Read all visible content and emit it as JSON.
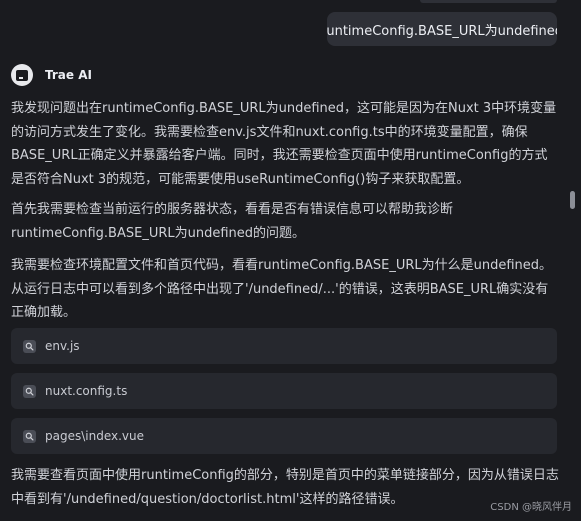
{
  "user_message": "runtimeConfig.BASE_URL为undefined",
  "assistant": {
    "name": "Trae AI"
  },
  "paragraphs": [
    "我发现问题出在runtimeConfig.BASE_URL为undefined，这可能是因为在Nuxt 3中环境变量的访问方式发生了变化。我需要检查env.js文件和nuxt.config.ts中的环境变量配置，确保BASE_URL正确定义并暴露给客户端。同时，我还需要检查页面中使用runtimeConfig的方式是否符合Nuxt 3的规范，可能需要使用useRuntimeConfig()钩子来获取配置。",
    "首先我需要检查当前运行的服务器状态，看看是否有错误信息可以帮助我诊断runtimeConfig.BASE_URL为undefined的问题。",
    "我需要检查环境配置文件和首页代码，看看runtimeConfig.BASE_URL为什么是undefined。从运行日志中可以看到多个路径中出现了'/undefined/...'的错误，这表明BASE_URL确实没有正确加载。",
    "我需要查看页面中使用runtimeConfig的部分，特别是首页中的菜单链接部分，因为从错误日志中看到有'/undefined/question/doctorlist.html'这样的路径错误。"
  ],
  "files": [
    {
      "name": "env.js",
      "icon": "search-icon"
    },
    {
      "name": "nuxt.config.ts",
      "icon": "search-icon"
    },
    {
      "name": "pages\\index.vue",
      "icon": "search-icon"
    }
  ],
  "watermark": "CSDN @晓风伴月"
}
